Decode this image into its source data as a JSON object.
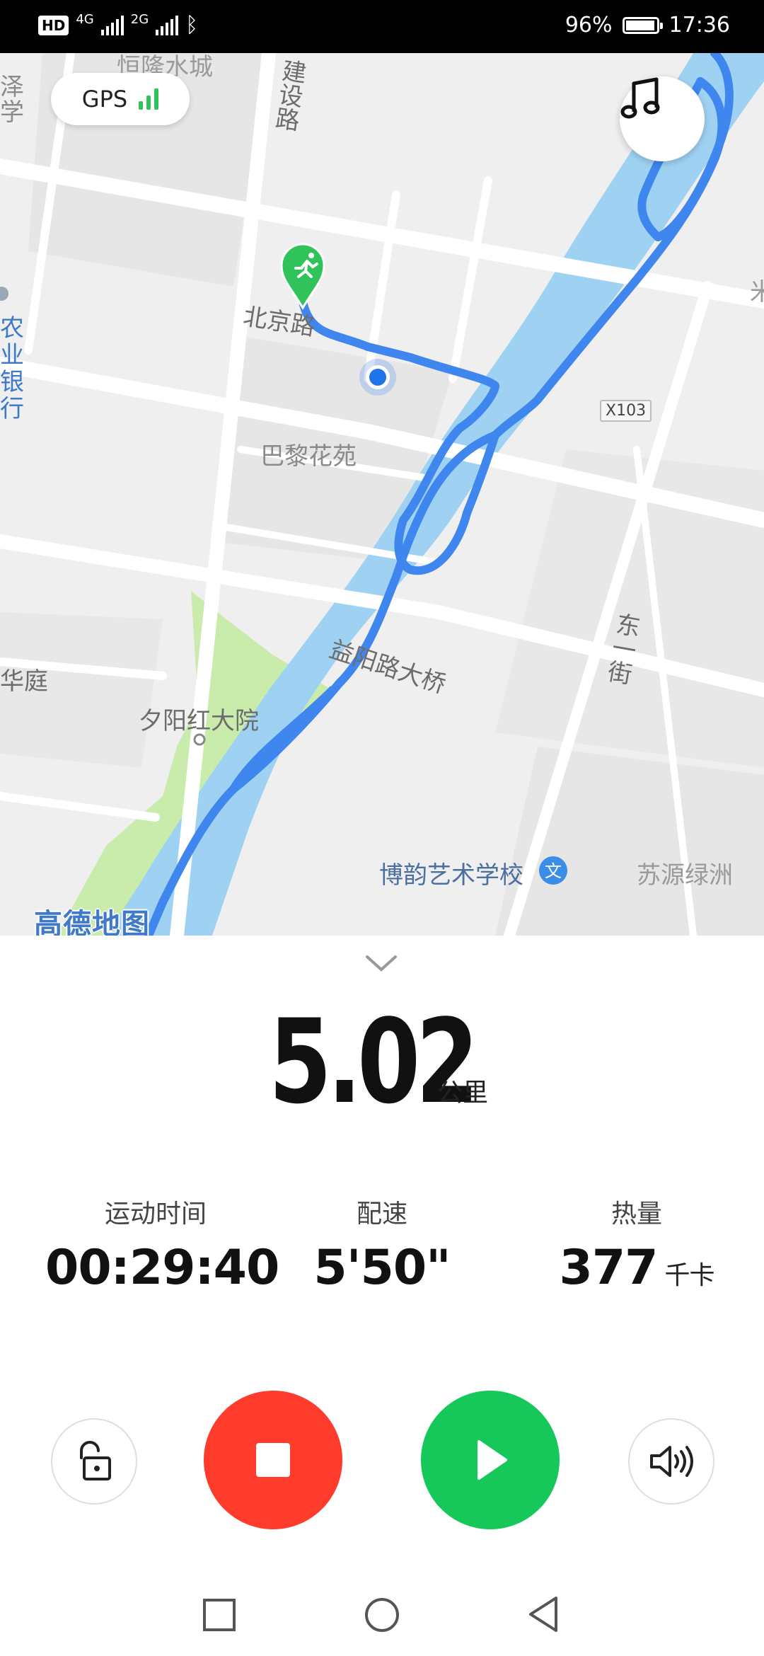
{
  "status_bar": {
    "hd": "HD",
    "sim1": "4G",
    "sim2": "2G",
    "battery": "96%",
    "battery_level": 0.96,
    "time": "17:36"
  },
  "map": {
    "gps_label": "GPS",
    "music_icon": "music-note-icon",
    "labels": {
      "top_block": "恒隆水城",
      "jianshe_road": "建设路",
      "left_top": "泽学",
      "bank": "农业银行",
      "beijing_road": "北京路",
      "bali": "巴黎花苑",
      "x103": "X103",
      "dongyi": "东一街",
      "yiyang_bridge": "益阳路大桥",
      "huating": "华庭",
      "xiyang": "夕阳红大院",
      "boyun": "博韵艺术学校",
      "suyuan": "苏源绿洲",
      "right_edge": "米"
    },
    "watermark": "高德地图",
    "route_color": "#3f86ee",
    "river_color": "#9fd2f2",
    "park_color": "#c7eba8",
    "start_marker_color": "#2fc35a"
  },
  "workout": {
    "distance": "5.02",
    "distance_unit": "公里",
    "duration_label": "运动时间",
    "duration": "00:29:40",
    "pace_label": "配速",
    "pace": "5'50\"",
    "calories_label": "热量",
    "calories": "377",
    "calories_unit": "千卡"
  },
  "controls": {
    "lock_icon": "unlock-icon",
    "stop_icon": "stop-icon",
    "stop_color": "#ff3b2c",
    "resume_icon": "play-icon",
    "resume_color": "#16c85a",
    "sound_icon": "speaker-icon"
  },
  "nav_bar": {
    "recent_icon": "square-icon",
    "home_icon": "circle-icon",
    "back_icon": "triangle-back-icon"
  }
}
